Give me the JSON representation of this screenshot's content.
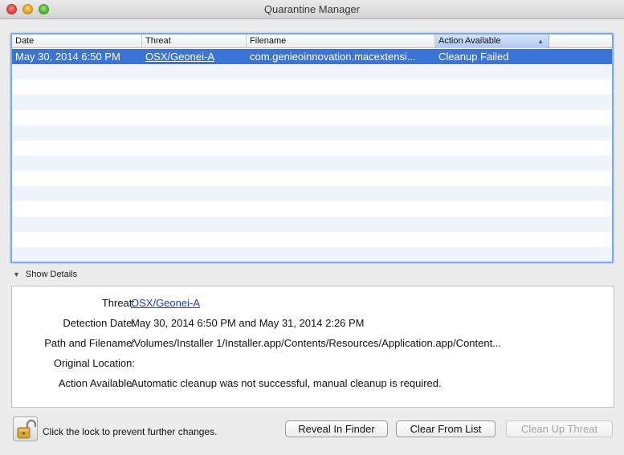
{
  "window": {
    "title": "Quarantine Manager"
  },
  "table": {
    "columns": [
      "Date",
      "Threat",
      "Filename",
      "Action Available"
    ],
    "sorted_column": "Action Available",
    "rows": [
      {
        "date": "May 30, 2014 6:50 PM",
        "threat": "OSX/Geonei-A",
        "filename": "com.genieoinnovation.macextensi...",
        "action": "Cleanup Failed",
        "selected": true
      }
    ]
  },
  "details_toggle": {
    "label": "Show Details",
    "expanded": true
  },
  "details": {
    "threat_label": "Threat:",
    "threat_value": "OSX/Geonei-A",
    "detection_label": "Detection Date:",
    "detection_value": "May 30, 2014 6:50 PM and May 31, 2014 2:26 PM",
    "path_label": "Path and Filename:",
    "path_value": "/Volumes/Installer 1/Installer.app/Contents/Resources/Application.app/Content...",
    "origin_label": "Original Location:",
    "origin_value": "",
    "action_label": "Action Available:",
    "action_value": "Automatic cleanup was not successful, manual cleanup is required."
  },
  "footer": {
    "lock_text": "Click the lock to prevent further changes.",
    "reveal_button": "Reveal In Finder",
    "clear_button": "Clear From List",
    "cleanup_button": "Clean Up Threat"
  },
  "colors": {
    "selection": "#3a74d6",
    "link": "#1a40c8",
    "focus_ring": "#7fa8e6"
  }
}
